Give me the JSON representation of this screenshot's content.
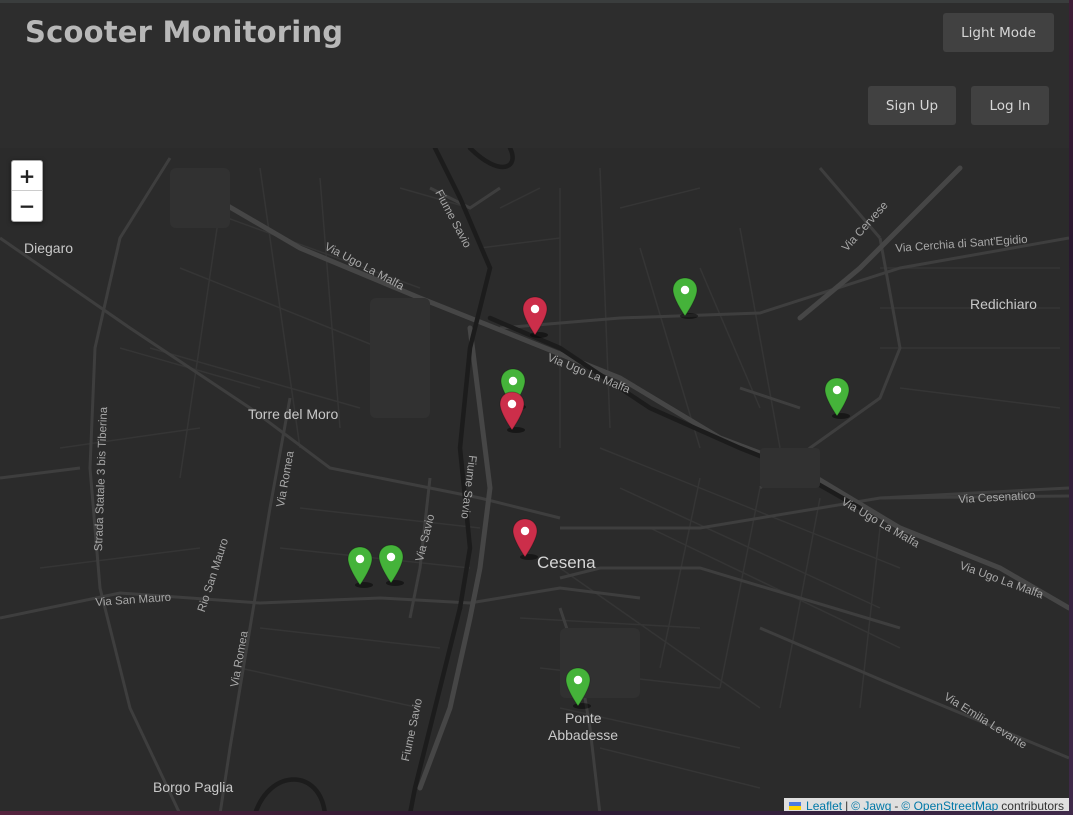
{
  "header": {
    "title": "Scooter Monitoring",
    "theme_button": "Light Mode",
    "signup_button": "Sign Up",
    "login_button": "Log In"
  },
  "map": {
    "zoom_in": "+",
    "zoom_out": "−",
    "places": {
      "diegaro": "Diegaro",
      "redichiaro": "Redichiaro",
      "torre_del_moro": "Torre del Moro",
      "cesena": "Cesena",
      "ponte_abbadesse_1": "Ponte",
      "ponte_abbadesse_2": "Abbadesse",
      "borgo_paglia": "Borgo Paglia"
    },
    "roads": {
      "fiume_savio_1": "Fiume Savio",
      "fiume_savio_2": "Fiume Savio",
      "fiume_savio_3": "Fiume Savio",
      "via_ugo_la_malfa_1": "Via Ugo La Malfa",
      "via_ugo_la_malfa_2": "Via Ugo La Malfa",
      "via_ugo_la_malfa_3": "Via Ugo La Malfa",
      "via_ugo_la_malfa_4": "Via Ugo La Malfa",
      "via_cervese": "Via Cervese",
      "via_cerchia": "Via Cerchia di Sant'Egidio",
      "via_cesenatico": "Via Cesenatico",
      "via_savio": "Via Savio",
      "via_romea_1": "Via Romea",
      "via_romea_2": "Via Romea",
      "rio_san_mauro": "Rio San Mauro",
      "via_san_mauro": "Via San Mauro",
      "strada_statale": "Strada Statale 3 bis Tiberina",
      "via_emilia_levante": "Via Emilia Levante"
    },
    "marker_colors": {
      "available": "#45b33a",
      "alert": "#cc2e4a"
    },
    "markers": [
      {
        "status": "alert"
      },
      {
        "status": "available"
      },
      {
        "status": "available"
      },
      {
        "status": "alert"
      },
      {
        "status": "available"
      },
      {
        "status": "alert"
      },
      {
        "status": "available"
      },
      {
        "status": "available"
      },
      {
        "status": "available"
      }
    ]
  },
  "attribution": {
    "leaflet": "Leaflet",
    "sep1": "|",
    "jawg": "© Jawg",
    "sep2": "-",
    "osm": "© OpenStreetMap",
    "contributors": "contributors"
  }
}
